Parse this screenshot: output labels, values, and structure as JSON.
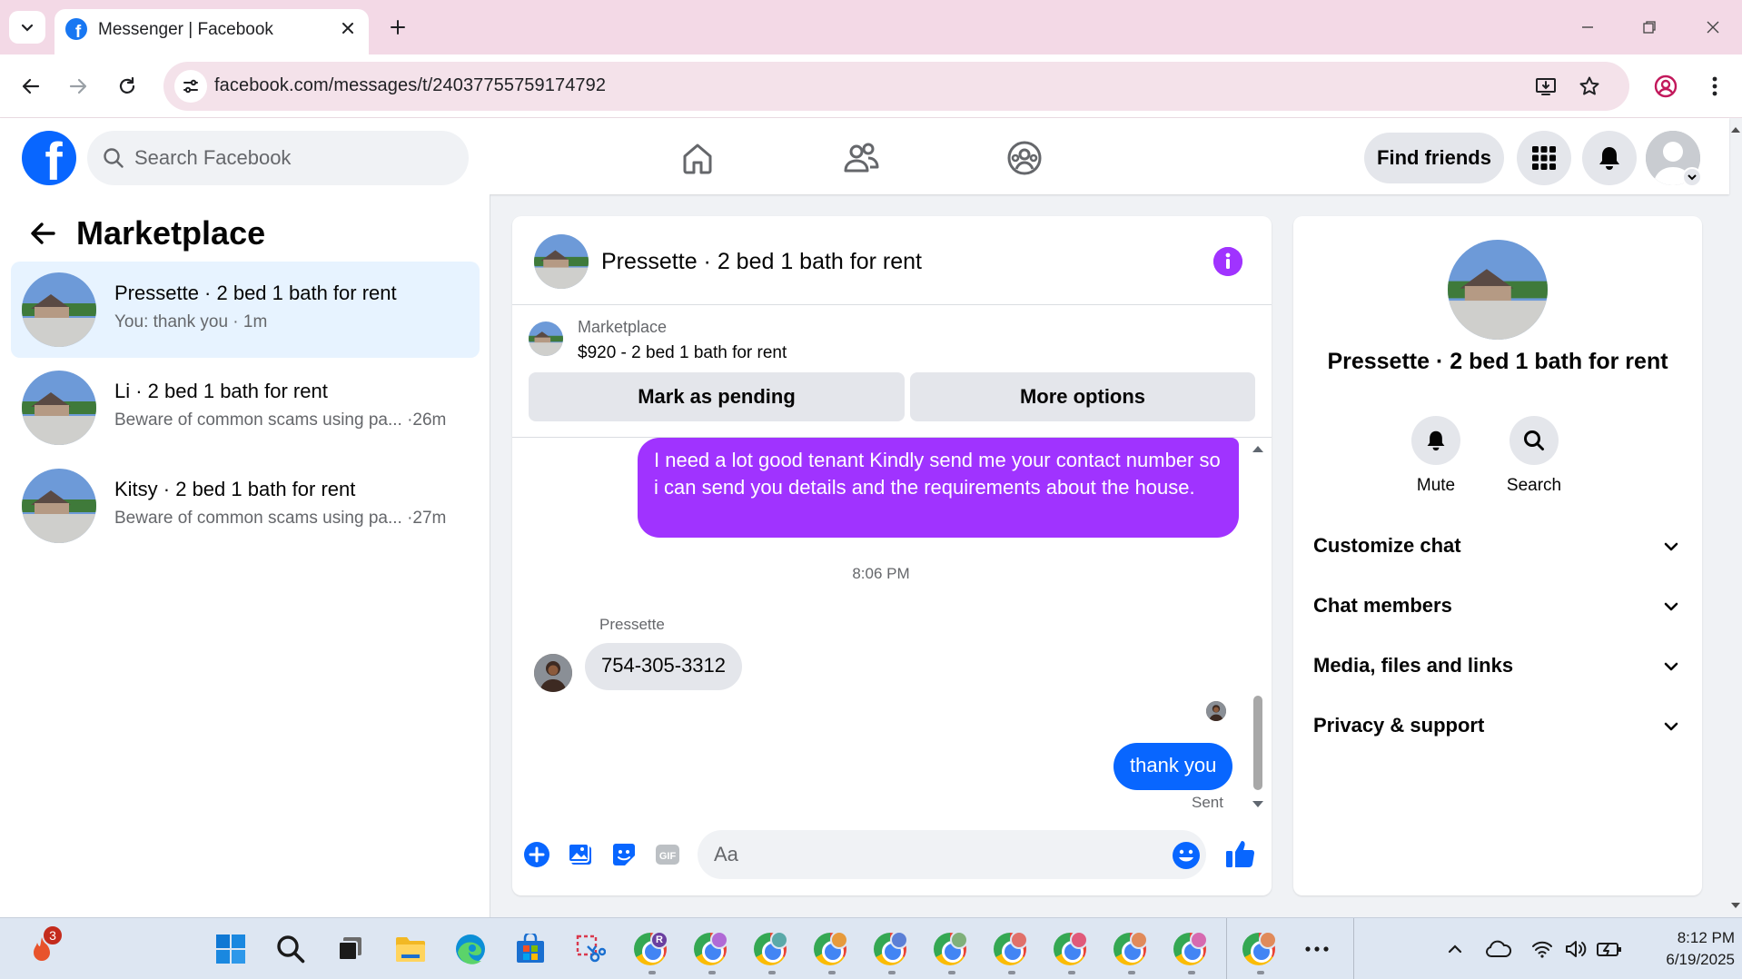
{
  "browser": {
    "tab_title": "Messenger | Facebook",
    "url": "facebook.com/messages/t/24037755759174792"
  },
  "fb_header": {
    "logo_letter": "f",
    "search_placeholder": "Search Facebook",
    "find_friends_label": "Find friends"
  },
  "sidebar": {
    "title": "Marketplace",
    "conversations": [
      {
        "title": "Pressette · 2 bed 1 bath for rent",
        "subtitle": "You: thank you · 1m",
        "active": true
      },
      {
        "title": "Li · 2 bed 1 bath for rent",
        "subtitle": "Beware of common scams using pa... ·26m",
        "active": false
      },
      {
        "title": "Kitsy · 2 bed 1 bath for rent",
        "subtitle": "Beware of common scams using pa... ·27m",
        "active": false
      }
    ]
  },
  "chat": {
    "header_title": "Pressette · 2 bed 1 bath for rent",
    "listing": {
      "kicker": "Marketplace",
      "title": "$920 - 2 bed 1 bath for rent",
      "btn_pending": "Mark as pending",
      "btn_more": "More options"
    },
    "messages": {
      "outgoing_1": "I need a lot good tenant Kindly send me your contact number so i can send you details and the requirements about the house.",
      "timestamp": "8:06 PM",
      "sender_name": "Pressette",
      "incoming_1": "754-305-3312",
      "outgoing_2": "thank you",
      "status": "Sent"
    },
    "composer_placeholder": "Aa"
  },
  "info_panel": {
    "title": "Pressette · 2 bed 1 bath for rent",
    "actions": [
      {
        "label": "Mute",
        "icon": "bell-icon"
      },
      {
        "label": "Search",
        "icon": "search-icon"
      }
    ],
    "sections": [
      "Customize chat",
      "Chat members",
      "Media, files and links",
      "Privacy & support"
    ]
  },
  "taskbar": {
    "notification_count": "3",
    "time": "8:12 PM",
    "date": "6/19/2025",
    "pinned_icons": [
      "start-icon",
      "search-icon",
      "task-view-icon",
      "file-explorer-icon",
      "edge-icon",
      "store-icon",
      "snipping-tool-icon"
    ],
    "chrome_profiles": [
      "R",
      "",
      "",
      "",
      "",
      "",
      "",
      "",
      "",
      "",
      ""
    ]
  },
  "colors": {
    "fb_blue": "#0866ff",
    "messenger_purple": "#a033ff",
    "active_row": "#e7f3ff",
    "tab_bar": "#f3d9e6"
  }
}
